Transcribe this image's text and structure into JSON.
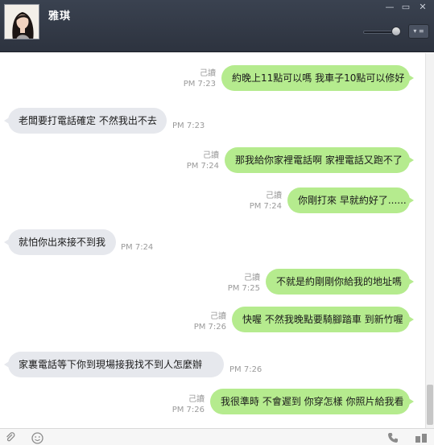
{
  "window": {
    "contact_name": "雅琪",
    "controls": {
      "minimize": "—",
      "maximize": "▭",
      "close": "✕"
    },
    "menu_glyph": "▾ ≡"
  },
  "messages": [
    {
      "dir": "out",
      "text": "約晚上11點可以嗎 我車子10點可以修好",
      "read": "己讀",
      "time": "PM 7:23"
    },
    {
      "dir": "in",
      "text": "老闆要打電話確定 不然我出不去",
      "time": "PM 7:23"
    },
    {
      "dir": "out",
      "text": "那我給你家裡電話啊 家裡電話又跑不了",
      "read": "己讀",
      "time": "PM 7:24"
    },
    {
      "dir": "out",
      "text": "你剛打來 早就約好了......",
      "read": "己讀",
      "time": "PM 7:24"
    },
    {
      "dir": "in",
      "text": "就怕你出來接不到我",
      "time": "PM 7:24"
    },
    {
      "dir": "out",
      "text": "不就是約剛剛你給我的地址嗎",
      "read": "己讀",
      "time": "PM 7:25"
    },
    {
      "dir": "out",
      "text": "快喔 不然我晚點要騎腳踏車 到新竹喔",
      "read": "己讀",
      "time": "PM 7:26"
    },
    {
      "dir": "in",
      "text": "家裏電話等下你到現場接我找不到人怎麼辦",
      "time": "PM 7:26"
    },
    {
      "dir": "out",
      "text": "我很準時 不會遲到 你穿怎樣 你照片給我看",
      "read": "己讀",
      "time": "PM 7:26"
    }
  ],
  "colors": {
    "outgoing_bubble": "#b5eb8e",
    "incoming_bubble": "#e6e8ed",
    "titlebar": "#2d333f"
  },
  "icons": {
    "attach": "paperclip-icon",
    "emoji": "emoji-icon",
    "call": "phone-icon",
    "more": "more-icon"
  }
}
